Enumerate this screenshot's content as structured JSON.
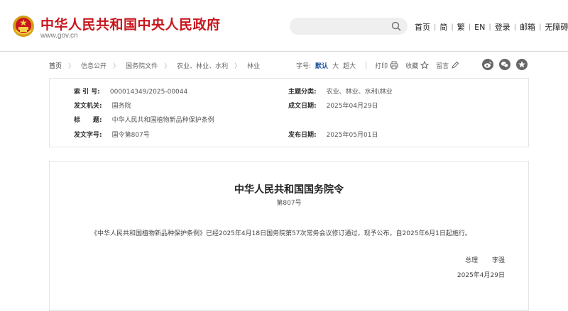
{
  "header": {
    "site_title": "中华人民共和国中央人民政府",
    "site_url": "www.gov.cn",
    "search_placeholder": "",
    "nav": [
      "首页",
      "简",
      "繁",
      "EN",
      "登录",
      "邮箱",
      "无障碍"
    ]
  },
  "breadcrumb": [
    "首页",
    "信息公开",
    "国务院文件",
    "农业、林业、水利",
    "林业"
  ],
  "tools": {
    "font_label": "字号:",
    "font_sizes": [
      "默认",
      "大",
      "超大"
    ],
    "active_font": "默认",
    "print": "打印",
    "favorite": "收藏",
    "comment": "留言"
  },
  "meta": {
    "index_label": "索 引 号:",
    "index_value": "000014349/2025-00044",
    "topic_label": "主题分类:",
    "topic_value": "农业、林业、水利\\林业",
    "issuer_label": "发文机关:",
    "issuer_value": "国务院",
    "written_label": "成文日期:",
    "written_value": "2025年04月29日",
    "title_label": "标　　题:",
    "title_value": "中华人民共和国植物新品种保护条例",
    "doc_no_label": "发文字号:",
    "doc_no_value": "国令第807号",
    "publish_label": "发布日期:",
    "publish_value": "2025年05月01日"
  },
  "article": {
    "title": "中华人民共和国国务院令",
    "number": "第807号",
    "body": "《中华人民共和国植物新品种保护条例》已经2025年4月18日国务院第57次常务会议修订通过，现予公布，自2025年6月1日起施行。",
    "sign_title": "总理",
    "sign_name": "李强",
    "date": "2025年4月29日"
  },
  "colors": {
    "brand_red": "#c8161d",
    "link_blue": "#1a4fa0"
  },
  "icons": [
    "national-emblem-icon",
    "search-icon",
    "print-icon",
    "star-icon",
    "pencil-icon",
    "weibo-icon",
    "wechat-icon",
    "share-icon"
  ]
}
